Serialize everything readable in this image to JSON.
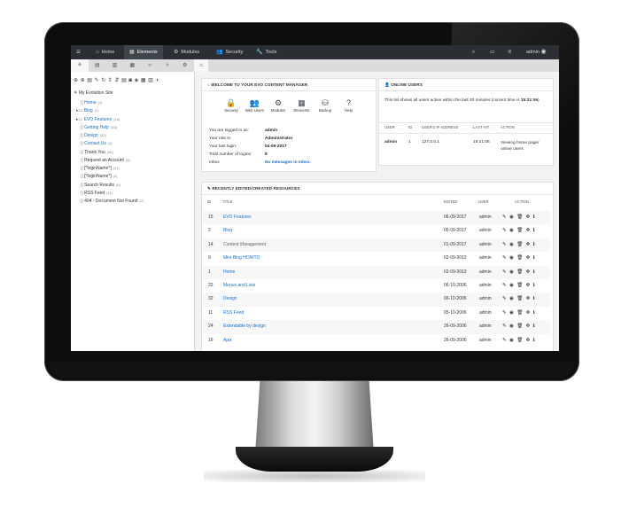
{
  "topbar": {
    "menu_icon": "hamburger-icon",
    "items": [
      {
        "label": "Home",
        "icon": "home-icon"
      },
      {
        "label": "Elements",
        "icon": "grid-icon"
      },
      {
        "label": "Modules",
        "icon": "cogs-icon"
      },
      {
        "label": "Security",
        "icon": "users-icon"
      },
      {
        "label": "Tools",
        "icon": "wrench-icon"
      }
    ],
    "right_icons": [
      "search-icon",
      "monitor-icon",
      "sliders-icon"
    ],
    "user": "admin"
  },
  "sidebar": {
    "tabs": [
      "sitemap-icon",
      "list-icon",
      "table-icon",
      "grid-icon",
      "code-icon",
      "plug-icon",
      "cogs-icon"
    ],
    "tools": [
      "⊕",
      "⊕",
      "▤",
      "✎",
      "↻",
      "⇕",
      "⇵",
      "▤",
      "◙",
      "◈",
      "▦",
      "▥",
      "◑"
    ],
    "root": "My Evolution Site",
    "items": [
      {
        "label": "Home",
        "count": "(1)",
        "kind": "link"
      },
      {
        "label": "Blog",
        "count": "(2)",
        "kind": "link"
      },
      {
        "label": "EVO Features",
        "count": "(18)",
        "kind": "link"
      },
      {
        "label": "Getting Help",
        "count": "(53)",
        "kind": "link"
      },
      {
        "label": "Design",
        "count": "(32)",
        "kind": "link"
      },
      {
        "label": "Contact Us",
        "count": "(6)",
        "kind": "link"
      },
      {
        "label": "Thank You",
        "count": "(46)",
        "kind": "plain"
      },
      {
        "label": "Request an Account",
        "count": "(5)",
        "kind": "plain"
      },
      {
        "label": "[*loginName*]",
        "count": "(37)",
        "kind": "plain"
      },
      {
        "label": "[*loginName*]",
        "count": "(4)",
        "kind": "plain"
      },
      {
        "label": "Search Results",
        "count": "(9)",
        "kind": "plain"
      },
      {
        "label": "RSS Feed",
        "count": "(11)",
        "kind": "plain"
      },
      {
        "label": "404 - Document Not Found",
        "count": "(7)",
        "kind": "plain"
      }
    ]
  },
  "welcome": {
    "title": "WELCOME TO YOUR EVO CONTENT MANAGER",
    "shortcuts": [
      {
        "label": "Security",
        "icon": "lock-icon",
        "glyph": "🔒"
      },
      {
        "label": "Web Users",
        "icon": "users-icon",
        "glyph": "👥"
      },
      {
        "label": "Modules",
        "icon": "cogs-icon",
        "glyph": "⚙"
      },
      {
        "label": "Elements",
        "icon": "grid-icon",
        "glyph": "▦"
      },
      {
        "label": "Backup",
        "icon": "database-icon",
        "glyph": "⛁"
      },
      {
        "label": "Help",
        "icon": "help-icon",
        "glyph": "?"
      }
    ],
    "info": [
      {
        "label": "You are logged in as:",
        "value": "admin",
        "kind": "plain"
      },
      {
        "label": "Your role is:",
        "value": "Administrator",
        "kind": "plain"
      },
      {
        "label": "Your last login:",
        "value": "04-09-2017",
        "kind": "plain"
      },
      {
        "label": "Total number of logins:",
        "value": "8",
        "kind": "plain"
      },
      {
        "label": "Inbox",
        "value": "No messages in Inbox.",
        "kind": "blue"
      }
    ]
  },
  "online": {
    "title": "ONLINE USERS",
    "text": "This list shows all users active within the last 20 minutes (current time is",
    "time": "15:21:06",
    "columns": [
      "USER",
      "ID",
      "USER'S IP ADDRESS",
      "LAST HIT",
      "ACTION"
    ],
    "row": {
      "user": "admin",
      "id": "1",
      "ip": "127.0.0.1",
      "last_hit": "15:21:06",
      "action": "Viewing home page/ online users"
    }
  },
  "recent": {
    "title": "RECENTLY EDITED/CREATED RESOURCES",
    "columns": [
      "ID",
      "TITLE",
      "EDITED",
      "USER",
      "ACTION"
    ],
    "rows": [
      {
        "id": "15",
        "title": "EVO Features",
        "edited": "06-09-2017",
        "user": "admin",
        "italic": false
      },
      {
        "id": "2",
        "title": "Blog",
        "edited": "05-09-2017",
        "user": "admin",
        "italic": false
      },
      {
        "id": "14",
        "title": "Content Management",
        "edited": "01-09-2017",
        "user": "admin",
        "italic": true
      },
      {
        "id": "9",
        "title": "Mini-Blog HOWTO",
        "edited": "02-09-2013",
        "user": "admin",
        "italic": false
      },
      {
        "id": "1",
        "title": "Home",
        "edited": "02-09-2013",
        "user": "admin",
        "italic": false
      },
      {
        "id": "22",
        "title": "Menus and Lists",
        "edited": "06-10-2006",
        "user": "admin",
        "italic": false
      },
      {
        "id": "32",
        "title": "Design",
        "edited": "06-10-2006",
        "user": "admin",
        "italic": false
      },
      {
        "id": "11",
        "title": "RSS Feed",
        "edited": "05-10-2006",
        "user": "admin",
        "italic": false
      },
      {
        "id": "24",
        "title": "Extendable by design",
        "edited": "26-09-2006",
        "user": "admin",
        "italic": false
      },
      {
        "id": "16",
        "title": "Ajax",
        "edited": "26-09-2006",
        "user": "admin",
        "italic": false
      }
    ],
    "action_icons": [
      "edit-icon",
      "view-icon",
      "delete-icon",
      "move-icon",
      "info-icon"
    ]
  }
}
